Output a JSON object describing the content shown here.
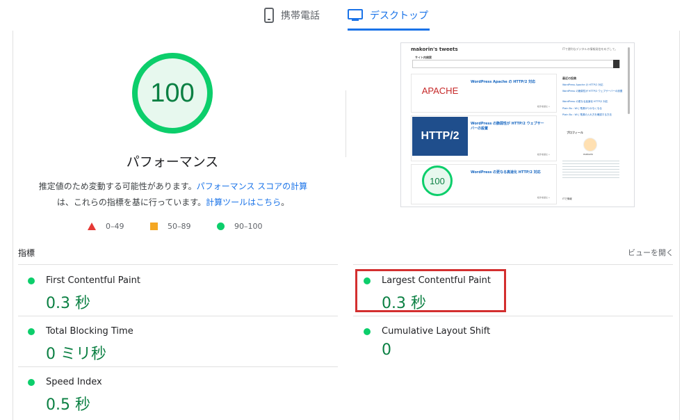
{
  "tabs": {
    "mobile": "携帯電話",
    "desktop": "デスクトップ"
  },
  "score": {
    "value": "100",
    "label": "パフォーマンス"
  },
  "description": {
    "text1": "推定値のため変動する可能性があります。",
    "link1": "パフォーマンス スコアの計算",
    "text2": "は、これらの指標を基に行っています。",
    "link2": "計算ツールはこちら",
    "text3": "。"
  },
  "legend": {
    "fail": "0–49",
    "average": "50–89",
    "pass": "90–100"
  },
  "colors": {
    "pass": "#0cce6b",
    "average": "#f4a723",
    "fail": "#e53935",
    "accent": "#1a73e8",
    "highlight": "#d32f2f"
  },
  "screenshot": {
    "site_title": "makorin's tweets",
    "site_tagline": "ITで便利なデジタルの情報発信をめざして。",
    "search_label": "サイト内検索",
    "sidebar_recent": "最近の投稿",
    "sidebar_profile": "プロフィール",
    "profile_name": "makorin",
    "sidebar_new": "ITで情報",
    "post1_title": "WordPress Apache の HTTP/2 対応",
    "post2_title": "WordPress の脆弱性が HTTP/2 ウェブサーバーの設置",
    "post3_title": "WordPress の更なる高速化 HTTP/2 対応",
    "post1_tag": "APACHE",
    "post2_tag": "HTTP/2",
    "post3_tag": "100",
    "more": "続きを読む »",
    "sidebar_links": [
      "WordPress Apache の HTTP/2 対応",
      "WordPress の脆弱性が HTTP/2 ウェブサーバーの設置",
      "WordPress の更なる高速化 HTTP/2 対応",
      "Plain Bu : Wi | 電源がつかなくなる",
      "Plain Bu : Wi | 電源の入れ方を確認する方法"
    ]
  },
  "metrics": {
    "label": "指標",
    "expand": "ビューを開く",
    "fcp": {
      "name": "First Contentful Paint",
      "value": "0.3 秒"
    },
    "lcp": {
      "name": "Largest Contentful Paint",
      "value": "0.3 秒"
    },
    "tbt": {
      "name": "Total Blocking Time",
      "value": "0 ミリ秒"
    },
    "cls": {
      "name": "Cumulative Layout Shift",
      "value": "0"
    },
    "si": {
      "name": "Speed Index",
      "value": "0.5 秒"
    }
  }
}
